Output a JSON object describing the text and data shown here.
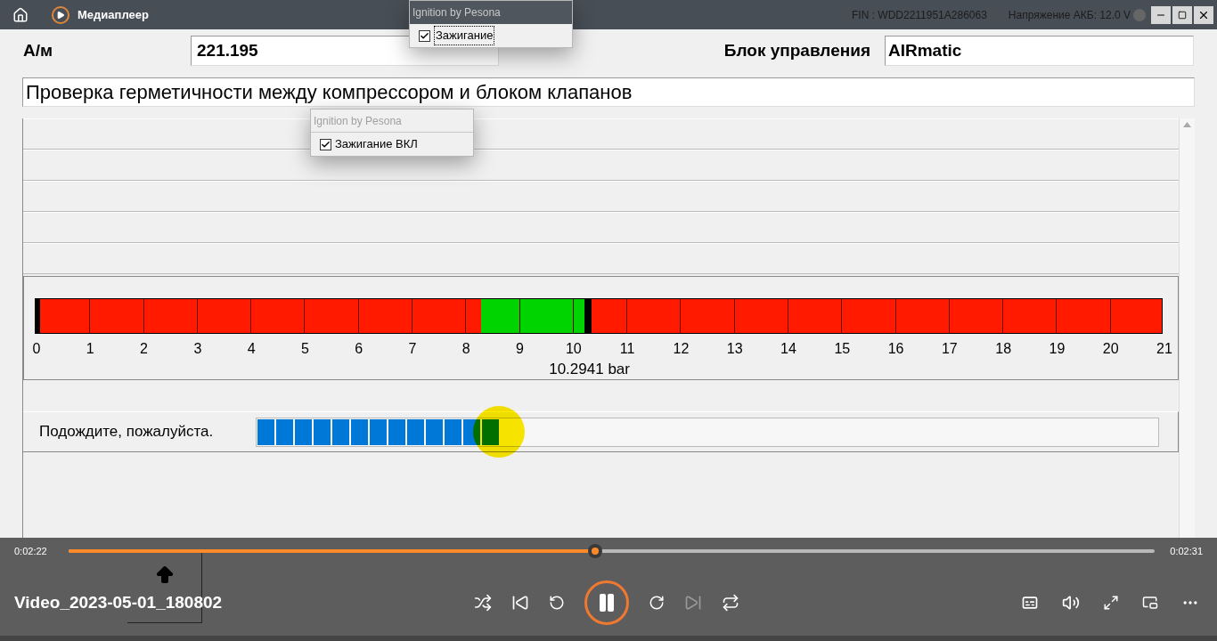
{
  "title_bar": {
    "app_title": "Медиаплеер",
    "fin": "FIN : WDD2211951A286063",
    "voltage": "Напряжение АКБ: 12.0 V"
  },
  "popups": [
    {
      "title": "Ignition by Pesona",
      "label": "Зажигание",
      "checked": true
    },
    {
      "title": "Ignition by Pesona",
      "label": "Зажигание ВКЛ",
      "checked": true
    }
  ],
  "vehicle": {
    "label": "А/м",
    "value": "221.195"
  },
  "control_unit": {
    "label": "Блок управления",
    "value": "AIRmatic"
  },
  "test_title": "Проверка герметичности между компрессором и блоком клапанов",
  "gauge": {
    "ticks": [
      "0",
      "1",
      "2",
      "3",
      "4",
      "5",
      "6",
      "7",
      "8",
      "9",
      "10",
      "11",
      "12",
      "13",
      "14",
      "15",
      "16",
      "17",
      "18",
      "19",
      "20",
      "21"
    ],
    "level": 0.4902,
    "reading": "10.2941 bar"
  },
  "wait": {
    "label": "Подождите, пожалуйста.",
    "level": 0.27
  },
  "player": {
    "elapsed": "0:02:22",
    "total": "0:02:31",
    "level": 0.485,
    "video_title": "Video_2023-05-01_180802",
    "playing": true
  }
}
